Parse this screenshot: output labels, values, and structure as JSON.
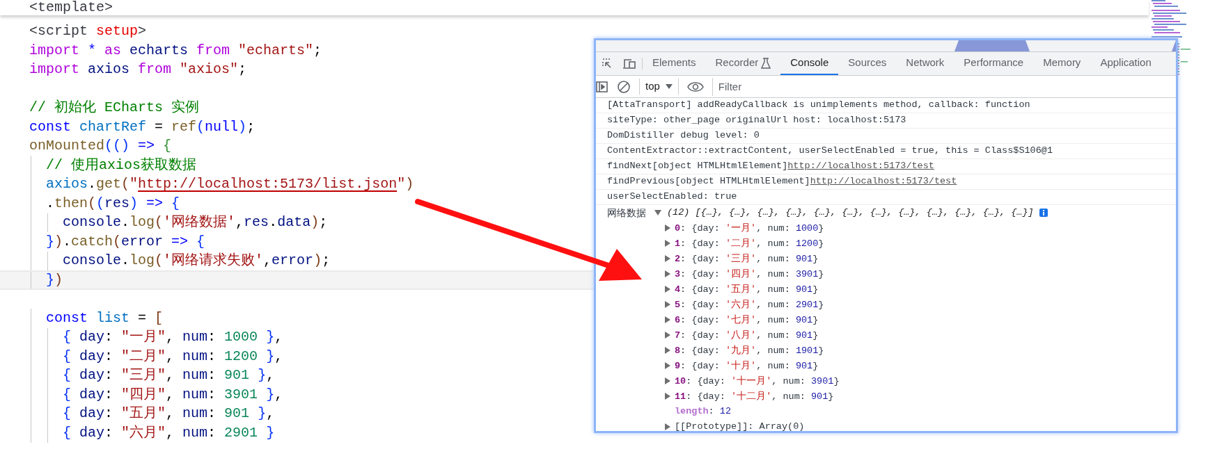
{
  "editor": {
    "sticky_line": {
      "tokens": [
        {
          "text": "<template>",
          "kind": "tag"
        }
      ]
    },
    "lines": [
      {
        "current": false
      },
      {
        "current": false,
        "tokens": [
          {
            "text": "<script",
            "kind": "tag"
          },
          {
            "text": " setup",
            "kind": "attr"
          },
          {
            "text": ">",
            "kind": "tag"
          }
        ]
      },
      {
        "current": false,
        "tokens": [
          {
            "text": "import",
            "kind": "keyword"
          },
          {
            "text": " *",
            "kind": "decl"
          },
          {
            "text": " as",
            "kind": "keyword"
          },
          {
            "text": " echarts",
            "kind": "ident"
          },
          {
            "text": " from",
            "kind": "keyword"
          },
          {
            "text": " \"echarts\"",
            "kind": "string"
          },
          {
            "text": ";",
            "kind": "punct"
          }
        ]
      },
      {
        "current": false,
        "tokens": [
          {
            "text": "import",
            "kind": "keyword"
          },
          {
            "text": " axios",
            "kind": "ident"
          },
          {
            "text": " from",
            "kind": "keyword"
          },
          {
            "text": " \"axios\"",
            "kind": "string"
          },
          {
            "text": ";",
            "kind": "punct"
          }
        ]
      },
      {
        "current": false
      },
      {
        "current": false,
        "tokens": [
          {
            "text": "// 初始化 ECharts 实例",
            "kind": "comment"
          }
        ]
      },
      {
        "current": false,
        "tokens": [
          {
            "text": "const",
            "kind": "decl"
          },
          {
            "text": " chartRef",
            "kind": "var"
          },
          {
            "text": " = ",
            "kind": "punct"
          },
          {
            "text": "ref",
            "kind": "func"
          },
          {
            "text": "(",
            "kind": "bracket1"
          },
          {
            "text": "null",
            "kind": "decl"
          },
          {
            "text": ")",
            "kind": "bracket1"
          },
          {
            "text": ";",
            "kind": "punct"
          }
        ]
      },
      {
        "current": false,
        "tokens": [
          {
            "text": "onMounted",
            "kind": "func"
          },
          {
            "text": "(()",
            "kind": "bracket1"
          },
          {
            "text": " => ",
            "kind": "decl"
          },
          {
            "text": "{",
            "kind": "bracket2"
          }
        ]
      },
      {
        "current": false,
        "tokens": [
          {
            "text": "  // 使用axios获取数据",
            "kind": "comment"
          }
        ]
      },
      {
        "current": false,
        "tokens": [
          {
            "text": "  axios",
            "kind": "var"
          },
          {
            "text": ".",
            "kind": "punct"
          },
          {
            "text": "get",
            "kind": "func"
          },
          {
            "text": "(",
            "kind": "bracket3"
          },
          {
            "text": "\"",
            "kind": "string"
          },
          {
            "text": "http://localhost:5173/list.json",
            "kind": "url"
          },
          {
            "text": "\"",
            "kind": "string"
          },
          {
            "text": ")",
            "kind": "bracket3"
          }
        ]
      },
      {
        "current": false,
        "tokens": [
          {
            "text": "  .",
            "kind": "punct"
          },
          {
            "text": "then",
            "kind": "func"
          },
          {
            "text": "(",
            "kind": "bracket3"
          },
          {
            "text": "(",
            "kind": "bracket1"
          },
          {
            "text": "res",
            "kind": "ident"
          },
          {
            "text": ")",
            "kind": "bracket1"
          },
          {
            "text": " => ",
            "kind": "decl"
          },
          {
            "text": "{",
            "kind": "bracket1"
          }
        ]
      },
      {
        "current": false,
        "tokens": [
          {
            "text": "    console",
            "kind": "ident"
          },
          {
            "text": ".",
            "kind": "punct"
          },
          {
            "text": "log",
            "kind": "func"
          },
          {
            "text": "(",
            "kind": "bracket3"
          },
          {
            "text": "'网络数据'",
            "kind": "string"
          },
          {
            "text": ",",
            "kind": "punct"
          },
          {
            "text": "res",
            "kind": "ident"
          },
          {
            "text": ".",
            "kind": "punct"
          },
          {
            "text": "data",
            "kind": "ident"
          },
          {
            "text": ")",
            "kind": "bracket3"
          },
          {
            "text": ";",
            "kind": "punct"
          }
        ]
      },
      {
        "current": false,
        "tokens": [
          {
            "text": "  }",
            "kind": "bracket1"
          },
          {
            "text": ")",
            "kind": "bracket3"
          },
          {
            "text": ".",
            "kind": "punct"
          },
          {
            "text": "catch",
            "kind": "func"
          },
          {
            "text": "(",
            "kind": "bracket3"
          },
          {
            "text": "error",
            "kind": "ident"
          },
          {
            "text": " => ",
            "kind": "decl"
          },
          {
            "text": "{",
            "kind": "bracket1"
          }
        ]
      },
      {
        "current": false,
        "tokens": [
          {
            "text": "    console",
            "kind": "ident"
          },
          {
            "text": ".",
            "kind": "punct"
          },
          {
            "text": "log",
            "kind": "func"
          },
          {
            "text": "(",
            "kind": "bracket3"
          },
          {
            "text": "'网络请求失败'",
            "kind": "string"
          },
          {
            "text": ",",
            "kind": "punct"
          },
          {
            "text": "error",
            "kind": "ident"
          },
          {
            "text": ")",
            "kind": "bracket3"
          },
          {
            "text": ";",
            "kind": "punct"
          }
        ]
      },
      {
        "current": true,
        "tokens": [
          {
            "text": "  }",
            "kind": "bracket1"
          },
          {
            "text": ")",
            "kind": "bracket3"
          }
        ]
      },
      {
        "current": false
      },
      {
        "current": false,
        "tokens": [
          {
            "text": "  const",
            "kind": "decl"
          },
          {
            "text": " list",
            "kind": "var"
          },
          {
            "text": " = ",
            "kind": "punct"
          },
          {
            "text": "[",
            "kind": "bracket3"
          }
        ]
      },
      {
        "current": false,
        "tokens": [
          {
            "text": "    {",
            "kind": "bracket1"
          },
          {
            "text": " day",
            "kind": "ident"
          },
          {
            "text": ": ",
            "kind": "punct"
          },
          {
            "text": "\"一月\"",
            "kind": "string"
          },
          {
            "text": ", ",
            "kind": "punct"
          },
          {
            "text": "num",
            "kind": "ident"
          },
          {
            "text": ": ",
            "kind": "punct"
          },
          {
            "text": "1000",
            "kind": "number"
          },
          {
            "text": " }",
            "kind": "bracket1"
          },
          {
            "text": ",",
            "kind": "punct"
          }
        ]
      },
      {
        "current": false,
        "tokens": [
          {
            "text": "    {",
            "kind": "bracket1"
          },
          {
            "text": " day",
            "kind": "ident"
          },
          {
            "text": ": ",
            "kind": "punct"
          },
          {
            "text": "\"二月\"",
            "kind": "string"
          },
          {
            "text": ", ",
            "kind": "punct"
          },
          {
            "text": "num",
            "kind": "ident"
          },
          {
            "text": ": ",
            "kind": "punct"
          },
          {
            "text": "1200",
            "kind": "number"
          },
          {
            "text": " }",
            "kind": "bracket1"
          },
          {
            "text": ",",
            "kind": "punct"
          }
        ]
      },
      {
        "current": false,
        "tokens": [
          {
            "text": "    {",
            "kind": "bracket1"
          },
          {
            "text": " day",
            "kind": "ident"
          },
          {
            "text": ": ",
            "kind": "punct"
          },
          {
            "text": "\"三月\"",
            "kind": "string"
          },
          {
            "text": ", ",
            "kind": "punct"
          },
          {
            "text": "num",
            "kind": "ident"
          },
          {
            "text": ": ",
            "kind": "punct"
          },
          {
            "text": "901",
            "kind": "number"
          },
          {
            "text": " }",
            "kind": "bracket1"
          },
          {
            "text": ",",
            "kind": "punct"
          }
        ]
      },
      {
        "current": false,
        "tokens": [
          {
            "text": "    {",
            "kind": "bracket1"
          },
          {
            "text": " day",
            "kind": "ident"
          },
          {
            "text": ": ",
            "kind": "punct"
          },
          {
            "text": "\"四月\"",
            "kind": "string"
          },
          {
            "text": ", ",
            "kind": "punct"
          },
          {
            "text": "num",
            "kind": "ident"
          },
          {
            "text": ": ",
            "kind": "punct"
          },
          {
            "text": "3901",
            "kind": "number"
          },
          {
            "text": " }",
            "kind": "bracket1"
          },
          {
            "text": ",",
            "kind": "punct"
          }
        ]
      },
      {
        "current": false,
        "tokens": [
          {
            "text": "    {",
            "kind": "bracket1"
          },
          {
            "text": " day",
            "kind": "ident"
          },
          {
            "text": ": ",
            "kind": "punct"
          },
          {
            "text": "\"五月\"",
            "kind": "string"
          },
          {
            "text": ", ",
            "kind": "punct"
          },
          {
            "text": "num",
            "kind": "ident"
          },
          {
            "text": ": ",
            "kind": "punct"
          },
          {
            "text": "901",
            "kind": "number"
          },
          {
            "text": " }",
            "kind": "bracket1"
          },
          {
            "text": ",",
            "kind": "punct"
          }
        ]
      },
      {
        "current": false,
        "tokens": [
          {
            "text": "    {",
            "kind": "bracket1"
          },
          {
            "text": " day",
            "kind": "ident"
          },
          {
            "text": ": ",
            "kind": "punct"
          },
          {
            "text": "\"六月\"",
            "kind": "string"
          },
          {
            "text": ", ",
            "kind": "punct"
          },
          {
            "text": "num",
            "kind": "ident"
          },
          {
            "text": ": ",
            "kind": "punct"
          },
          {
            "text": "2901",
            "kind": "number"
          },
          {
            "text": " }",
            "kind": "bracket1"
          }
        ]
      }
    ]
  },
  "devtools": {
    "tabs": [
      {
        "label": "Elements",
        "selected": false,
        "icon": false
      },
      {
        "label": "Recorder",
        "selected": false,
        "icon": true
      },
      {
        "label": "Console",
        "selected": true,
        "icon": false
      },
      {
        "label": "Sources",
        "selected": false,
        "icon": false
      },
      {
        "label": "Network",
        "selected": false,
        "icon": false
      },
      {
        "label": "Performance",
        "selected": false,
        "icon": false
      },
      {
        "label": "Memory",
        "selected": false,
        "icon": false
      },
      {
        "label": "Application",
        "selected": false,
        "icon": false
      }
    ],
    "context": "top",
    "filter": {
      "placeholder": "Filter"
    },
    "messages": [
      {
        "kind": "text",
        "text": "[AttaTransport] addReadyCallback is unimplements method, callback: function"
      },
      {
        "kind": "text",
        "text": "siteType: other_page originalUrl host: localhost:5173"
      },
      {
        "kind": "text",
        "text": "DomDistiller debug level: 0"
      },
      {
        "kind": "text",
        "text": "ContentExtractor::extractContent, userSelectEnabled = true, this = Class$S106@1"
      },
      {
        "kind": "link",
        "text": "findNext[object HTMLHtmlElement]",
        "url": "http://localhost:5173/test"
      },
      {
        "kind": "link",
        "text": "findPrevious[object HTMLHtmlElement]",
        "url": "http://localhost:5173/test"
      },
      {
        "kind": "text",
        "text": "userSelectEnabled: true"
      },
      {
        "kind": "array",
        "label": "网络数据",
        "expanded": true,
        "summary": "(12) [{…}, {…}, {…}, {…}, {…}, {…}, {…}, {…}, {…}, {…}, {…}, {…}]",
        "entries": [
          {
            "kind": "item",
            "tokens": [
              {
                "text": "0",
                "kind": "key"
              },
              {
                "text": ": {day: ",
                "kind": "punct"
              },
              {
                "text": "'一月'",
                "kind": "str"
              },
              {
                "text": ", num: ",
                "kind": "punct"
              },
              {
                "text": "1000",
                "kind": "num"
              },
              {
                "text": "}",
                "kind": "punct"
              }
            ]
          },
          {
            "kind": "item",
            "tokens": [
              {
                "text": "1",
                "kind": "key"
              },
              {
                "text": ": {day: ",
                "kind": "punct"
              },
              {
                "text": "'二月'",
                "kind": "str"
              },
              {
                "text": ", num: ",
                "kind": "punct"
              },
              {
                "text": "1200",
                "kind": "num"
              },
              {
                "text": "}",
                "kind": "punct"
              }
            ]
          },
          {
            "kind": "item",
            "tokens": [
              {
                "text": "2",
                "kind": "key"
              },
              {
                "text": ": {day: ",
                "kind": "punct"
              },
              {
                "text": "'三月'",
                "kind": "str"
              },
              {
                "text": ", num: ",
                "kind": "punct"
              },
              {
                "text": "901",
                "kind": "num"
              },
              {
                "text": "}",
                "kind": "punct"
              }
            ]
          },
          {
            "kind": "item",
            "tokens": [
              {
                "text": "3",
                "kind": "key"
              },
              {
                "text": ": {day: ",
                "kind": "punct"
              },
              {
                "text": "'四月'",
                "kind": "str"
              },
              {
                "text": ", num: ",
                "kind": "punct"
              },
              {
                "text": "3901",
                "kind": "num"
              },
              {
                "text": "}",
                "kind": "punct"
              }
            ]
          },
          {
            "kind": "item",
            "tokens": [
              {
                "text": "4",
                "kind": "key"
              },
              {
                "text": ": {day: ",
                "kind": "punct"
              },
              {
                "text": "'五月'",
                "kind": "str"
              },
              {
                "text": ", num: ",
                "kind": "punct"
              },
              {
                "text": "901",
                "kind": "num"
              },
              {
                "text": "}",
                "kind": "punct"
              }
            ]
          },
          {
            "kind": "item",
            "tokens": [
              {
                "text": "5",
                "kind": "key"
              },
              {
                "text": ": {day: ",
                "kind": "punct"
              },
              {
                "text": "'六月'",
                "kind": "str"
              },
              {
                "text": ", num: ",
                "kind": "punct"
              },
              {
                "text": "2901",
                "kind": "num"
              },
              {
                "text": "}",
                "kind": "punct"
              }
            ]
          },
          {
            "kind": "item",
            "tokens": [
              {
                "text": "6",
                "kind": "key"
              },
              {
                "text": ": {day: ",
                "kind": "punct"
              },
              {
                "text": "'七月'",
                "kind": "str"
              },
              {
                "text": ", num: ",
                "kind": "punct"
              },
              {
                "text": "901",
                "kind": "num"
              },
              {
                "text": "}",
                "kind": "punct"
              }
            ]
          },
          {
            "kind": "item",
            "tokens": [
              {
                "text": "7",
                "kind": "key"
              },
              {
                "text": ": {day: ",
                "kind": "punct"
              },
              {
                "text": "'八月'",
                "kind": "str"
              },
              {
                "text": ", num: ",
                "kind": "punct"
              },
              {
                "text": "901",
                "kind": "num"
              },
              {
                "text": "}",
                "kind": "punct"
              }
            ]
          },
          {
            "kind": "item",
            "tokens": [
              {
                "text": "8",
                "kind": "key"
              },
              {
                "text": ": {day: ",
                "kind": "punct"
              },
              {
                "text": "'九月'",
                "kind": "str"
              },
              {
                "text": ", num: ",
                "kind": "punct"
              },
              {
                "text": "1901",
                "kind": "num"
              },
              {
                "text": "}",
                "kind": "punct"
              }
            ]
          },
          {
            "kind": "item",
            "tokens": [
              {
                "text": "9",
                "kind": "key"
              },
              {
                "text": ": {day: ",
                "kind": "punct"
              },
              {
                "text": "'十月'",
                "kind": "str"
              },
              {
                "text": ", num: ",
                "kind": "punct"
              },
              {
                "text": "901",
                "kind": "num"
              },
              {
                "text": "}",
                "kind": "punct"
              }
            ]
          },
          {
            "kind": "item",
            "tokens": [
              {
                "text": "10",
                "kind": "key"
              },
              {
                "text": ": {day: ",
                "kind": "punct"
              },
              {
                "text": "'十一月'",
                "kind": "str"
              },
              {
                "text": ", num: ",
                "kind": "punct"
              },
              {
                "text": "3901",
                "kind": "num"
              },
              {
                "text": "}",
                "kind": "punct"
              }
            ]
          },
          {
            "kind": "item",
            "tokens": [
              {
                "text": "11",
                "kind": "key"
              },
              {
                "text": ": {day: ",
                "kind": "punct"
              },
              {
                "text": "'十二月'",
                "kind": "str"
              },
              {
                "text": ", num: ",
                "kind": "punct"
              },
              {
                "text": "901",
                "kind": "num"
              },
              {
                "text": "}",
                "kind": "punct"
              }
            ]
          },
          {
            "kind": "length",
            "tokens": [
              {
                "text": "length",
                "kind": "meta"
              },
              {
                "text": ": ",
                "kind": "punct"
              },
              {
                "text": "12",
                "kind": "num"
              }
            ]
          },
          {
            "kind": "item",
            "tokens": [
              {
                "text": "[[Prototype]]",
                "kind": "meta2"
              },
              {
                "text": ": Array(0)",
                "kind": "punct"
              }
            ]
          }
        ]
      }
    ]
  }
}
